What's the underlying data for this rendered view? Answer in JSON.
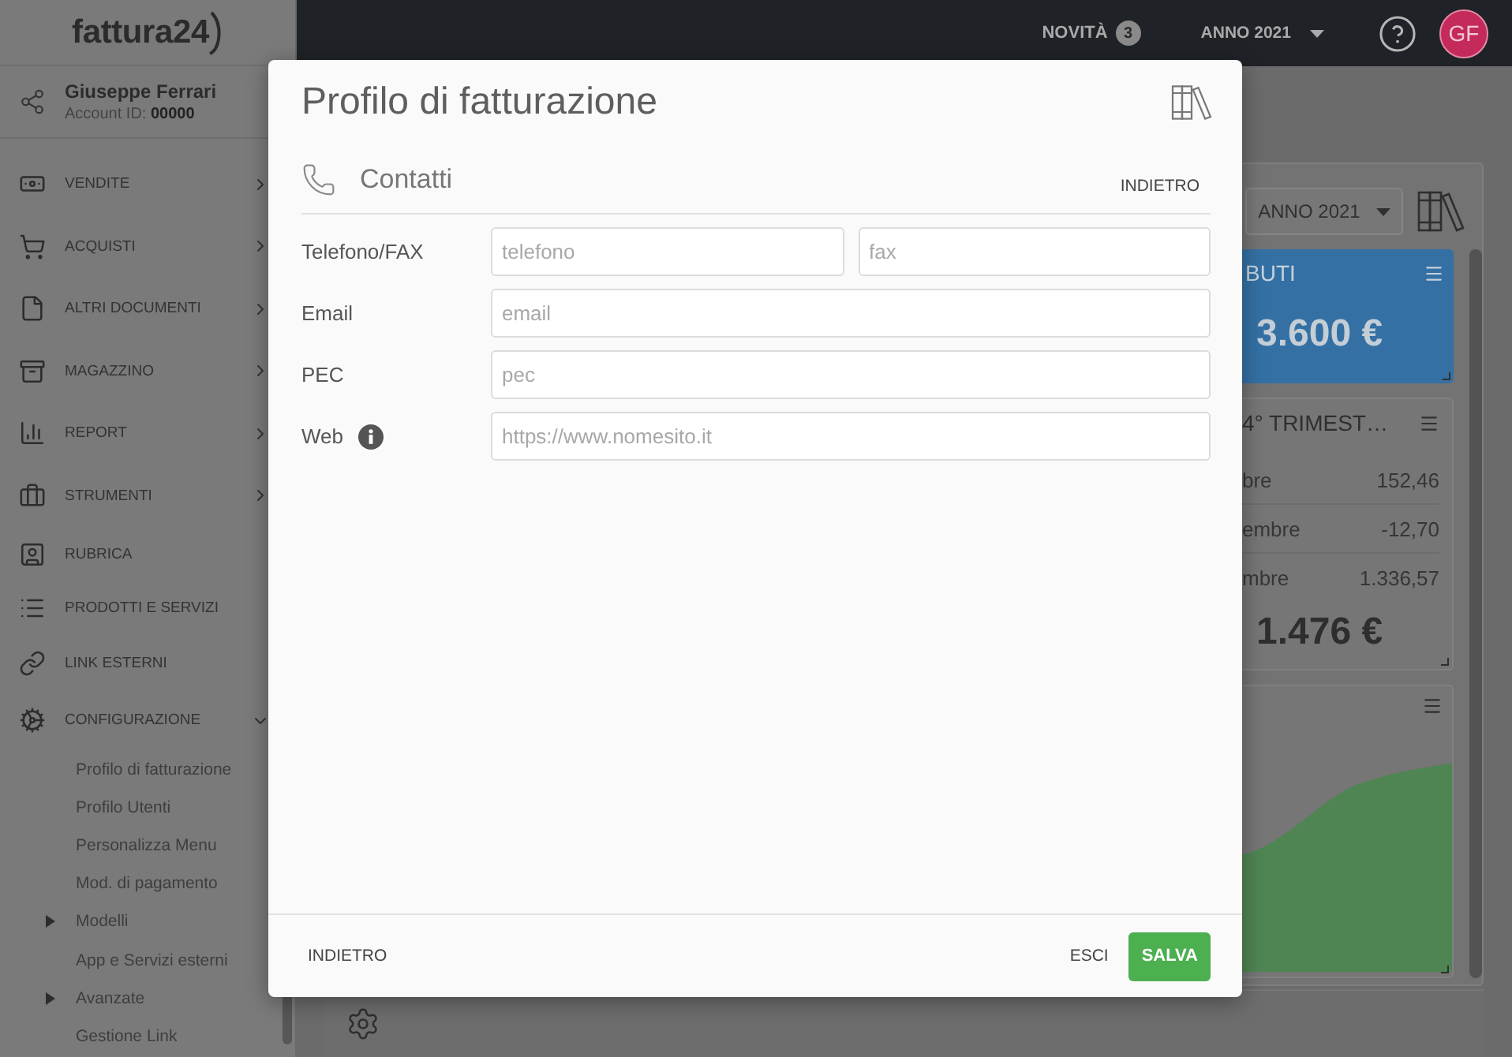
{
  "logo": "fattura24",
  "top_bar": {
    "news": {
      "label": "NOVITÀ",
      "count": "3"
    },
    "year": "ANNO 2021",
    "avatar": "GF"
  },
  "sidebar": {
    "user": {
      "name": "Giuseppe Ferrari",
      "account": "Account ID: **00000**"
    },
    "items": [
      {
        "label": "VENDITE",
        "kind": "group",
        "expanded": false
      },
      {
        "label": "ACQUISTI",
        "kind": "group",
        "expanded": false
      },
      {
        "label": "ALTRI DOCUMENTI",
        "kind": "group",
        "expanded": false
      },
      {
        "label": "MAGAZZINO",
        "kind": "group",
        "expanded": false
      },
      {
        "label": "REPORT",
        "kind": "group",
        "expanded": false
      },
      {
        "label": "STRUMENTI",
        "kind": "group",
        "expanded": false
      },
      {
        "label": "RUBRICA",
        "kind": "link"
      },
      {
        "label": "PRODOTTI E SERVIZI",
        "kind": "link"
      },
      {
        "label": "LINK ESTERNI",
        "kind": "link"
      },
      {
        "label": "CONFIGURAZIONE",
        "kind": "group",
        "expanded": true,
        "children": [
          {
            "label": "Profilo di fatturazione",
            "kind": "link"
          },
          {
            "label": "Profilo Utenti",
            "kind": "link"
          },
          {
            "label": "Personalizza Menu",
            "kind": "link"
          },
          {
            "label": "Mod. di pagamento",
            "kind": "link"
          },
          {
            "label": "Modelli",
            "kind": "group",
            "expanded": false
          },
          {
            "label": "App e Servizi esterni",
            "kind": "link"
          },
          {
            "label": "Avanzate",
            "kind": "group",
            "expanded": false
          },
          {
            "label": "Gestione Link",
            "kind": "link"
          }
        ]
      }
    ]
  },
  "dashboard": {
    "year_select": "ANNO 2021",
    "cards": [
      {
        "kind": "total",
        "title": "BUTI",
        "amount": "3.600 €"
      },
      {
        "kind": "table",
        "title": "4° TRIMEST…",
        "rows": [
          {
            "label": "bre",
            "value": "152,46"
          },
          {
            "label": "embre",
            "value": "-12,70"
          },
          {
            "label": "mbre",
            "value": "1.336,57"
          }
        ],
        "total": "1.476 €"
      },
      {
        "kind": "chart"
      }
    ]
  },
  "modal": {
    "title": "Profilo di fatturazione",
    "section": {
      "title": "Contatti",
      "back": "INDIETRO"
    },
    "fields": [
      {
        "label": "Telefono/FAX",
        "info": false,
        "inputs": [
          {
            "placeholder": "telefono"
          },
          {
            "placeholder": "fax"
          }
        ]
      },
      {
        "label": "Email",
        "info": false,
        "inputs": [
          {
            "placeholder": "email"
          }
        ]
      },
      {
        "label": "PEC",
        "info": false,
        "inputs": [
          {
            "placeholder": "pec"
          }
        ]
      },
      {
        "label": "Web",
        "info": true,
        "inputs": [
          {
            "placeholder": "https://www.nomesito.it"
          }
        ]
      }
    ],
    "footer": {
      "back": "INDIETRO",
      "cancel": "ESCI",
      "save": "SALVA"
    }
  }
}
